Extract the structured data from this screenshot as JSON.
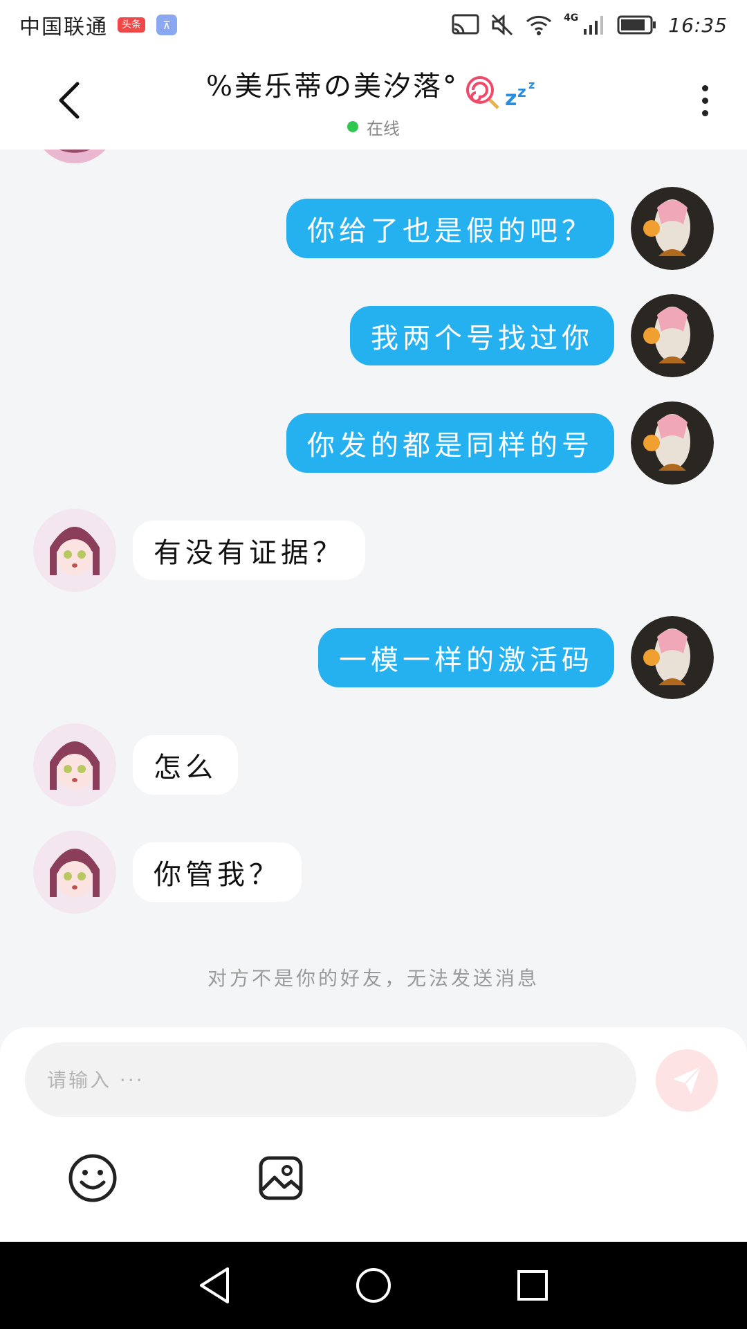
{
  "status_bar": {
    "carrier": "中国联通",
    "badge_toutiao": "头条",
    "network": "4G",
    "time": "16:35"
  },
  "header": {
    "title": "%美乐蒂の美汐落°",
    "status": "在线"
  },
  "messages": [
    {
      "side": "out",
      "text": "你给了也是假的吧？"
    },
    {
      "side": "out",
      "text": "我两个号找过你"
    },
    {
      "side": "out",
      "text": "你发的都是同样的号"
    },
    {
      "side": "in",
      "text": "有没有证据？"
    },
    {
      "side": "out",
      "text": "一模一样的激活码"
    },
    {
      "side": "in",
      "text": "怎么"
    },
    {
      "side": "in",
      "text": "你管我？"
    }
  ],
  "notice": "对方不是你的好友，无法发送消息",
  "input": {
    "placeholder": "请输入 ···"
  },
  "colors": {
    "outgoing_bubble": "#25b0f0",
    "incoming_bubble": "#ffffff",
    "online_dot": "#2dc84d",
    "send_button": "#fde3e3"
  }
}
